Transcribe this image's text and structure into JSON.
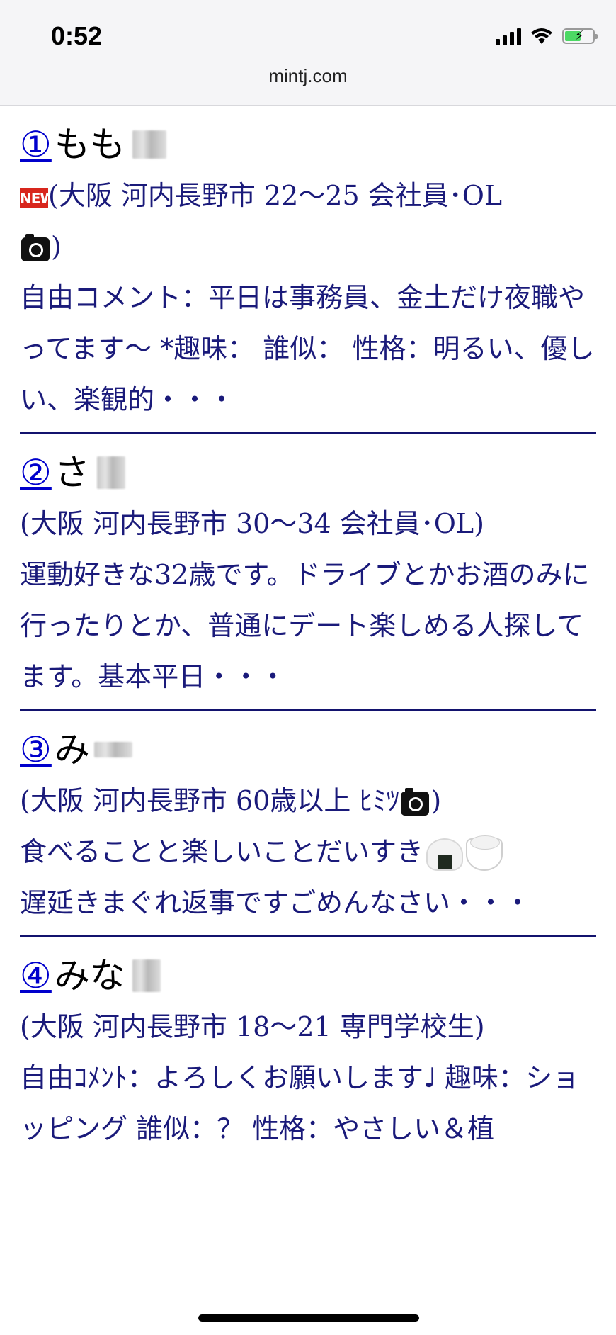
{
  "status_bar": {
    "time": "0:52",
    "url": "mintj.com"
  },
  "entries": [
    {
      "number": "①",
      "name": "もも",
      "badge": "NEW",
      "meta": "(大阪 河内長野市 22〜25 会社員･OL",
      "meta_close": ")",
      "comment": "自由コメント：平日は事務員、金土だけ夜職やってます〜 *趣味： 誰似： 性格：明るい、優しい、楽観的・・・"
    },
    {
      "number": "②",
      "name": "さ",
      "meta": "(大阪 河内長野市 30〜34 会社員･OL)",
      "comment": "運動好きな32歳です。ドライブとかお酒のみに行ったりとか、普通にデート楽しめる人探してます。基本平日・・・"
    },
    {
      "number": "③",
      "name": "み",
      "meta": "(大阪 河内長野市 60歳以上 ﾋﾐﾂ",
      "meta_close": ")",
      "comment_line1": "食べることと楽しいことだいすき",
      "comment_rest": "遅延きまぐれ返事ですごめんなさい・・・"
    },
    {
      "number": "④",
      "name": "みな",
      "meta": "(大阪 河内長野市 18〜21 専門学校生)",
      "comment": "自由ｺﾒﾝﾄ：よろしくお願いします♩ 趣味：ショッピング 誰似：？ 性格：やさしい＆植"
    }
  ],
  "colors": {
    "link": "#0000cc",
    "text": "#1a1a7a",
    "divider": "#13136e"
  },
  "icons": [
    "signal-icon",
    "wifi-icon",
    "battery-charging-icon",
    "new-badge-icon",
    "camera-icon",
    "onigiri-icon",
    "rice-bowl-icon"
  ]
}
